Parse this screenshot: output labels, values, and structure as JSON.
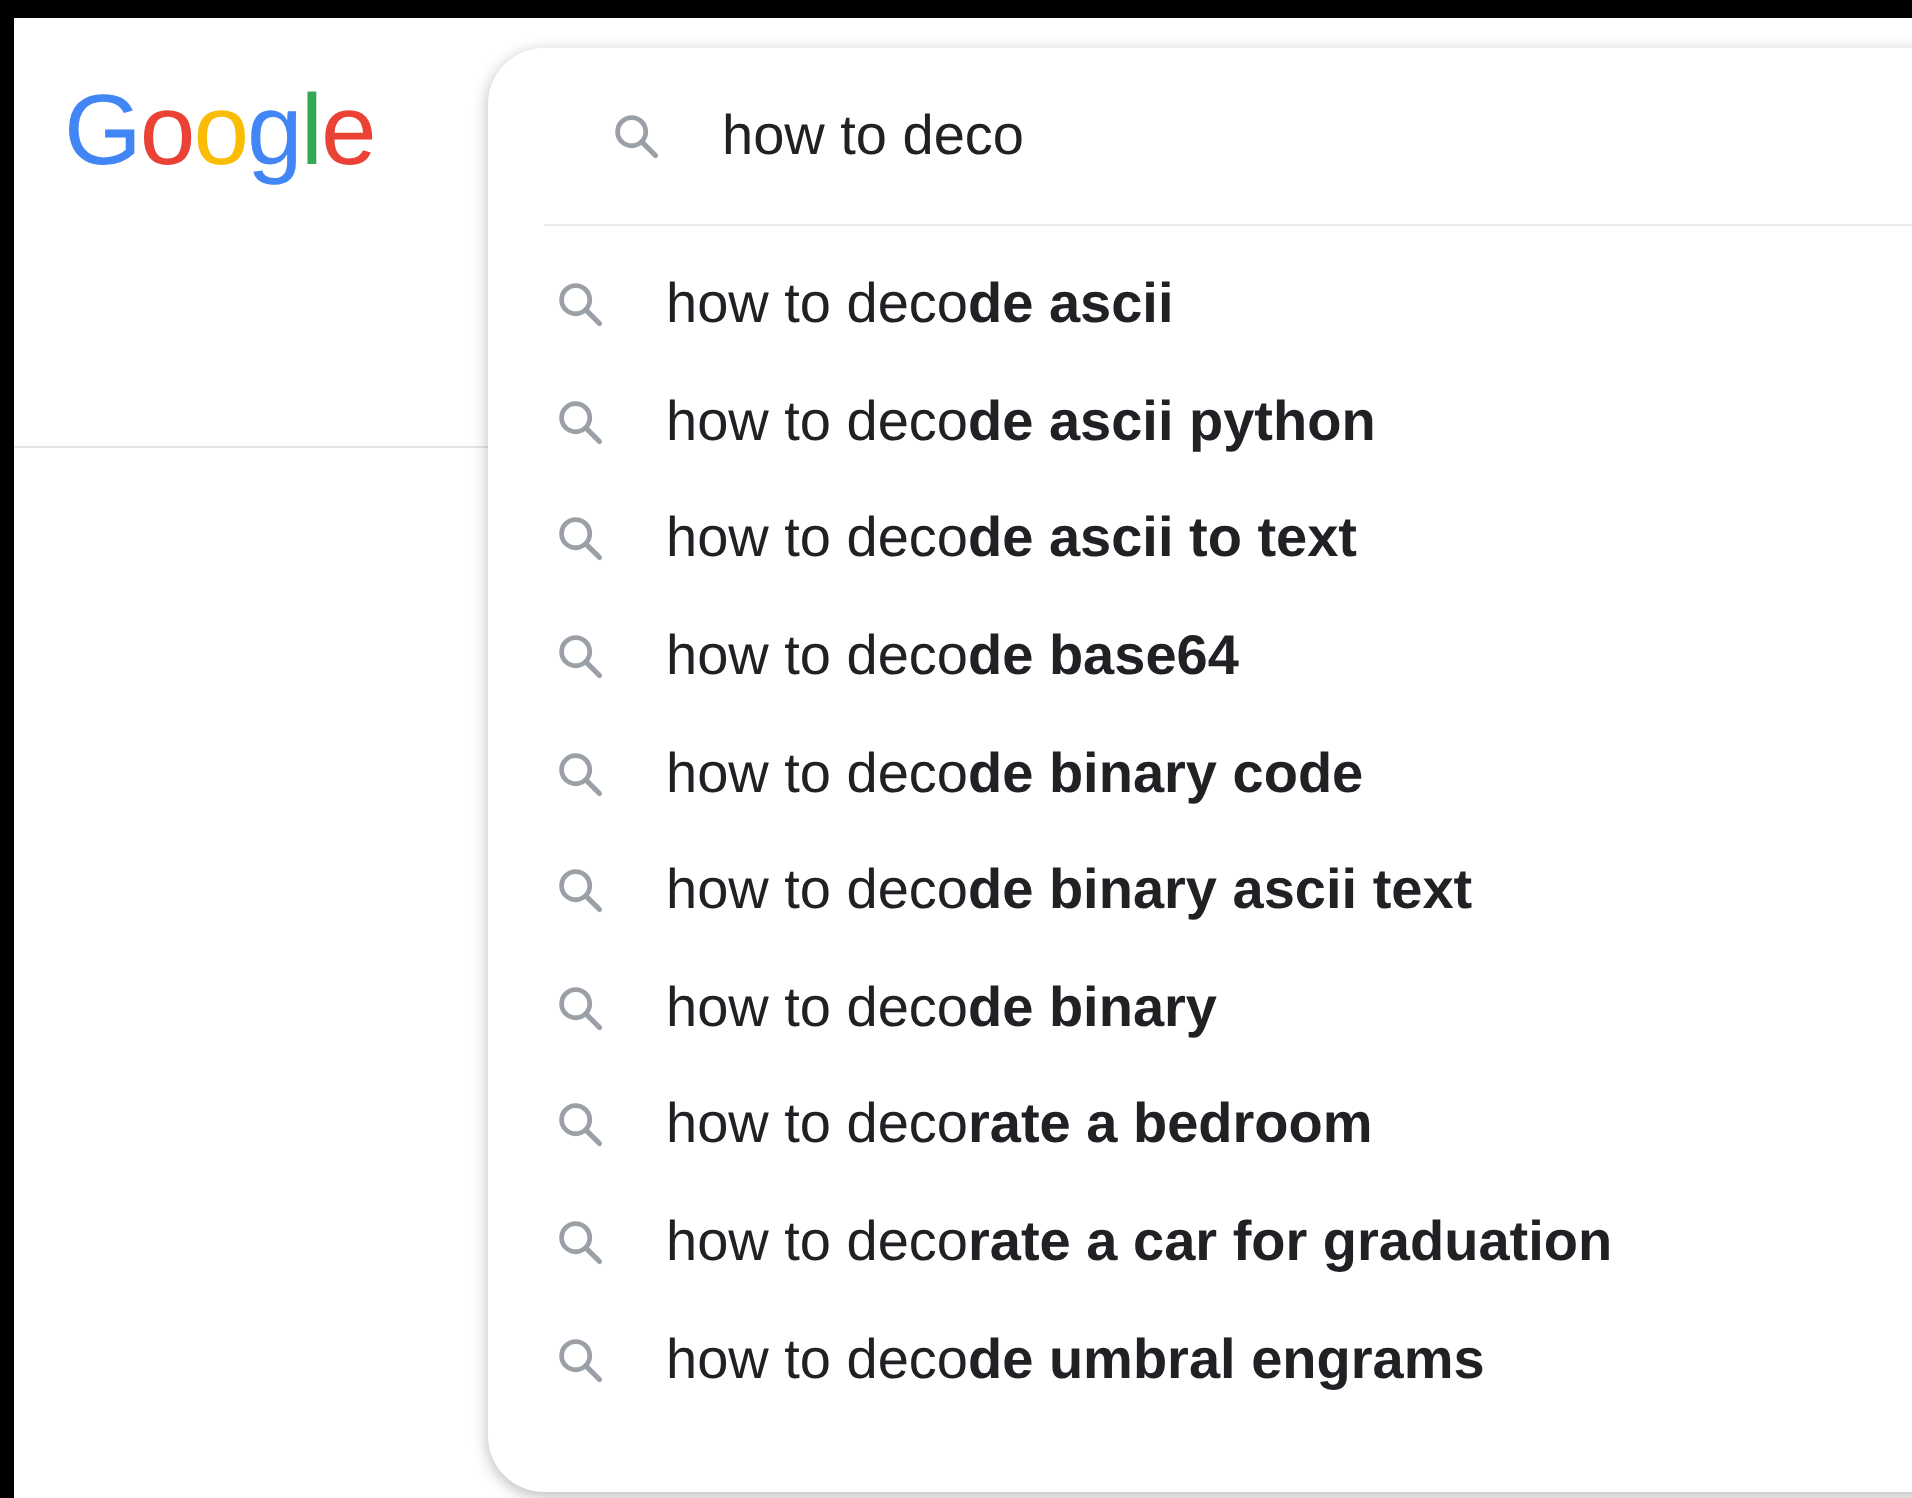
{
  "logo": "Google",
  "search": {
    "value": "how to deco"
  },
  "suggestions": [
    "how to deco**de ascii**",
    "how to deco**de ascii python**",
    "how to deco**de ascii to text**",
    "how to deco**de base64**",
    "how to deco**de binary code**",
    "how to deco**de binary ascii text**",
    "how to deco**de binary**",
    "how to deco**rate a bedroom**",
    "how to deco**rate a car for graduation**",
    "how to deco**de umbral engrams**"
  ]
}
